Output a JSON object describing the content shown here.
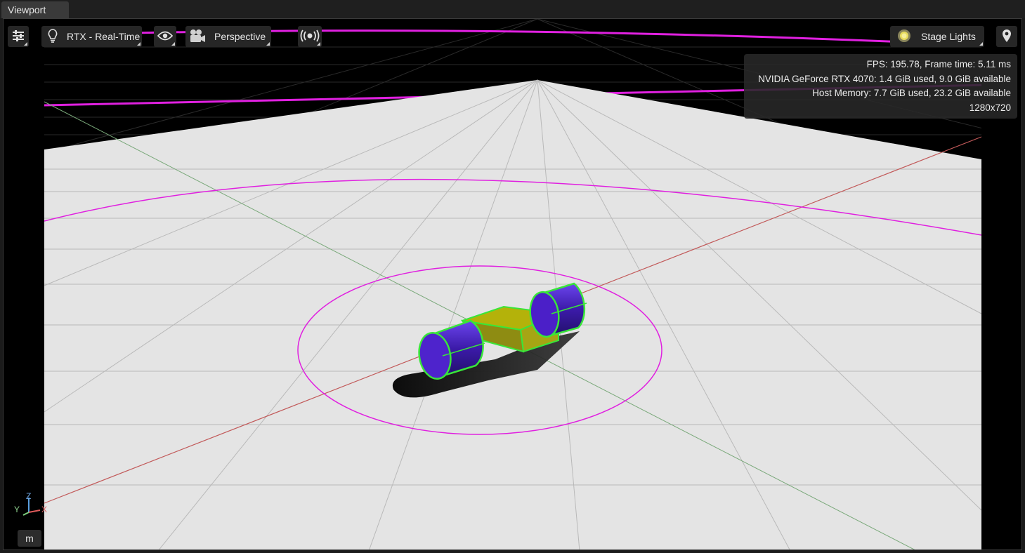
{
  "tab": {
    "title": "Viewport"
  },
  "toolbar": {
    "settings_icon": "sliders-icon",
    "render_mode": {
      "icon": "lightbulb-icon",
      "label": "RTX - Real-Time"
    },
    "visibility_icon": "eye-icon",
    "camera": {
      "icon": "movie-camera-icon",
      "label": "Perspective"
    },
    "live_icon": "broadcast-icon",
    "lighting": {
      "icon": "sun-icon",
      "label": "Stage Lights"
    },
    "location_icon": "map-pin-icon"
  },
  "stats": {
    "fps_line": "FPS: 195.78, Frame time: 5.11 ms",
    "gpu_line": "NVIDIA GeForce RTX 4070: 1.4 GiB used, 9.0 GiB available",
    "host_line": "Host Memory: 7.7 GiB used, 23.2 GiB available",
    "resolution": "1280x720"
  },
  "axis_gizmo": {
    "z": "Z",
    "y": "Y",
    "x": "X"
  },
  "units_button": {
    "label": "m"
  },
  "colors": {
    "selection_outline": "#39e639",
    "light_gizmo": "#e020e0",
    "wheel_color": "#4b1fc8",
    "chassis_color": "#b4b20a",
    "ground": "#e4e4e4"
  }
}
